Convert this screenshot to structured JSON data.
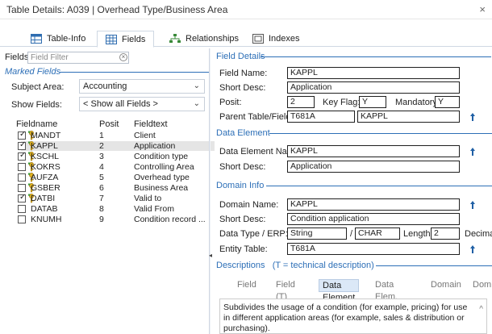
{
  "window": {
    "title": "Table Details: A039 | Overhead Type/Business Area",
    "close_glyph": "×"
  },
  "tabs": [
    {
      "label": "Table-Info",
      "icon": "table-icon"
    },
    {
      "label": "Fields",
      "icon": "fields-grid-icon"
    },
    {
      "label": "Relationships",
      "icon": "relationships-icon"
    },
    {
      "label": "Indexes",
      "icon": "indexes-icon"
    }
  ],
  "left": {
    "filter_label": "Fields",
    "filter_placeholder": "Field Filter",
    "marked_fields_header": "Marked Fields",
    "subject_area_label": "Subject Area:",
    "subject_area_value": "Accounting",
    "show_fields_label": "Show Fields:",
    "show_fields_value": "< Show all Fields >",
    "columns": [
      "Fieldname",
      "Posit",
      "Fieldtext"
    ],
    "rows": [
      {
        "name": "MANDT",
        "posit": "1",
        "text": "Client",
        "checked": true,
        "key": true,
        "selected": false
      },
      {
        "name": "KAPPL",
        "posit": "2",
        "text": "Application",
        "checked": true,
        "key": true,
        "selected": true
      },
      {
        "name": "KSCHL",
        "posit": "3",
        "text": "Condition type",
        "checked": true,
        "key": true,
        "selected": false
      },
      {
        "name": "KOKRS",
        "posit": "4",
        "text": "Controlling Area",
        "checked": false,
        "key": true,
        "selected": false
      },
      {
        "name": "AUFZA",
        "posit": "5",
        "text": "Overhead type",
        "checked": false,
        "key": true,
        "selected": false
      },
      {
        "name": "GSBER",
        "posit": "6",
        "text": "Business Area",
        "checked": false,
        "key": true,
        "selected": false
      },
      {
        "name": "DATBI",
        "posit": "7",
        "text": "Valid to",
        "checked": true,
        "key": true,
        "selected": false
      },
      {
        "name": "DATAB",
        "posit": "8",
        "text": "Valid From",
        "checked": false,
        "key": false,
        "selected": false
      },
      {
        "name": "KNUMH",
        "posit": "9",
        "text": "Condition record ...",
        "checked": false,
        "key": false,
        "selected": false
      }
    ]
  },
  "right": {
    "field_details_header": "Field Details",
    "field_name_label": "Field Name:",
    "field_name_value": "KAPPL",
    "short_desc_label": "Short Desc:",
    "short_desc_value": "Application",
    "posit_label": "Posit:",
    "posit_value": "2",
    "key_flag_label": "Key Flag:",
    "key_flag_value": "Y",
    "mandatory_label": "Mandatory:",
    "mandatory_value": "Y",
    "parent_label": "Parent Table/Field:",
    "parent_table_value": "T681A",
    "parent_field_value": "KAPPL",
    "data_element_header": "Data Element",
    "data_element_name_label": "Data Element Name:",
    "data_element_name_value": "KAPPL",
    "data_element_short_label": "Short Desc:",
    "data_element_short_value": "Application",
    "domain_info_header": "Domain Info",
    "domain_name_label": "Domain Name:",
    "domain_name_value": "KAPPL",
    "domain_short_label": "Short Desc:",
    "domain_short_value": "Condition application",
    "data_type_label": "Data Type / ERP:",
    "data_type_value": "String",
    "erp_type_value": "CHAR",
    "slash": "/",
    "length_label": "Length:",
    "length_value": "2",
    "decimals_label": "Decimals",
    "entity_table_label": "Entity Table:",
    "entity_table_value": "T681A",
    "descriptions_header": "Descriptions   (T = technical description)",
    "desc_tabs": [
      "Field",
      "Field (T)",
      "Data Element",
      "Data Elem. (T)",
      "Domain",
      "Dom"
    ],
    "desc_text": "Subdivides the usage of a condition (for example, pricing) for use in different application areas (for example, sales & distribution or purchasing)."
  }
}
